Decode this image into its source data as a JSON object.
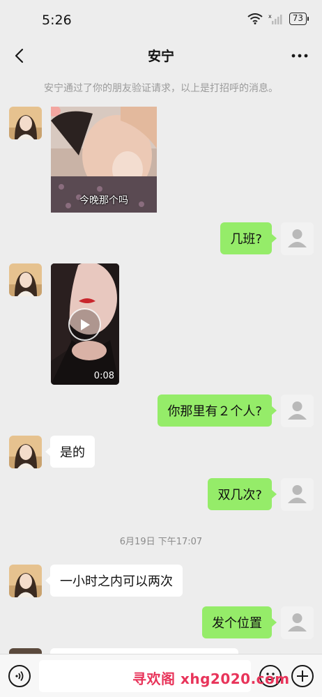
{
  "status_bar": {
    "time": "5:26",
    "battery": "73"
  },
  "header": {
    "title": "安宁",
    "back_icon": "chevron-left-icon",
    "more_icon": "more-dots-icon"
  },
  "system_message": "安宁通过了你的朋友验证请求，以上是打招呼的消息。",
  "messages": [
    {
      "from": "other",
      "type": "sticker",
      "caption": "今晚那个吗"
    },
    {
      "from": "me",
      "type": "text",
      "text": "几班?"
    },
    {
      "from": "other",
      "type": "video",
      "duration": "0:08"
    },
    {
      "from": "me",
      "type": "text",
      "text": "你那里有２个人?"
    },
    {
      "from": "other",
      "type": "text",
      "text": "是的"
    },
    {
      "from": "me",
      "type": "text",
      "text": "双几次?"
    },
    {
      "from": "other",
      "type": "text",
      "text": "一小时之内可以两次"
    },
    {
      "from": "me",
      "type": "text",
      "text": "发个位置"
    }
  ],
  "timestamp": "6月19日 下午17:07",
  "input_bar": {
    "placeholder": "",
    "voice_icon": "voice-icon",
    "emoji_icon": "emoji-icon",
    "plus_icon": "plus-icon"
  },
  "watermark": "寻欢阁 xhg2020.com",
  "colors": {
    "background": "#ededed",
    "my_bubble": "#95ec69",
    "other_bubble": "#ffffff",
    "watermark": "#e8345a"
  }
}
